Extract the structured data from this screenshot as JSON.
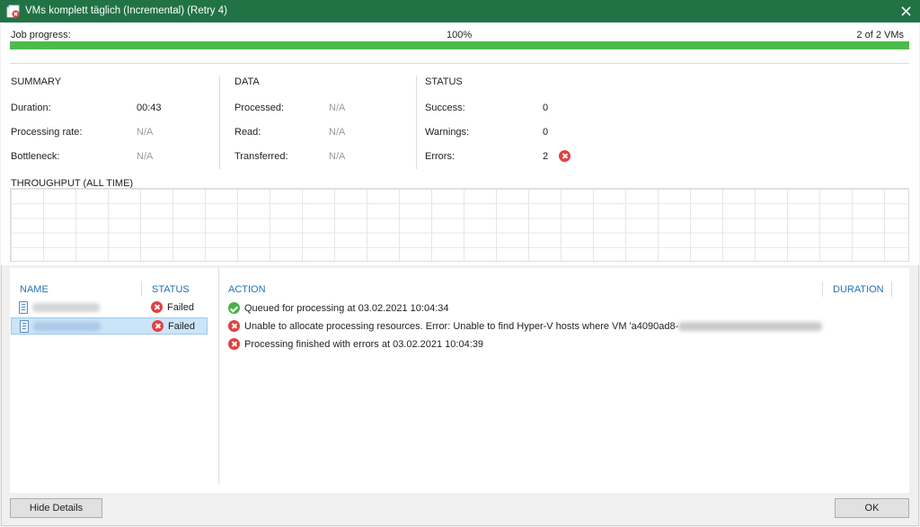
{
  "window": {
    "title": "VMs komplett täglich (Incremental) (Retry 4)",
    "accent_color": "#217346"
  },
  "progress": {
    "label": "Job progress:",
    "percent_text": "100%",
    "percent_value": 100,
    "count_text": "2 of 2 VMs",
    "bar_color": "#4cbb4c"
  },
  "summary": {
    "title": "SUMMARY",
    "rows": [
      {
        "label": "Duration:",
        "value": "00:43"
      },
      {
        "label": "Processing rate:",
        "value": "N/A"
      },
      {
        "label": "Bottleneck:",
        "value": "N/A"
      }
    ]
  },
  "data_section": {
    "title": "DATA",
    "rows": [
      {
        "label": "Processed:",
        "value": "N/A"
      },
      {
        "label": "Read:",
        "value": "N/A"
      },
      {
        "label": "Transferred:",
        "value": "N/A"
      }
    ]
  },
  "status_section": {
    "title": "STATUS",
    "rows": [
      {
        "label": "Success:",
        "value": "0"
      },
      {
        "label": "Warnings:",
        "value": "0"
      },
      {
        "label": "Errors:",
        "value": "2",
        "icon": "error-icon"
      }
    ]
  },
  "throughput": {
    "title": "THROUGHPUT (ALL TIME)"
  },
  "vm_list": {
    "headers": {
      "name": "NAME",
      "status": "STATUS"
    },
    "rows": [
      {
        "name": "",
        "status": "Failed",
        "icon": "vm-icon",
        "status_icon": "error-icon"
      },
      {
        "name": "",
        "status": "Failed",
        "icon": "vm-icon",
        "status_icon": "error-icon",
        "selected": true
      }
    ]
  },
  "actions": {
    "headers": {
      "action": "ACTION",
      "duration": "DURATION"
    },
    "rows": [
      {
        "icon": "success-icon",
        "text": "Queued for processing at 03.02.2021 10:04:34"
      },
      {
        "icon": "error-icon",
        "text": "Unable to allocate processing resources. Error: Unable to find Hyper-V hosts where VM 'a4090ad8-"
      },
      {
        "icon": "error-icon",
        "text": "Processing finished with errors at 03.02.2021 10:04:39"
      }
    ]
  },
  "buttons": {
    "hide_details": "Hide Details",
    "ok": "OK"
  }
}
